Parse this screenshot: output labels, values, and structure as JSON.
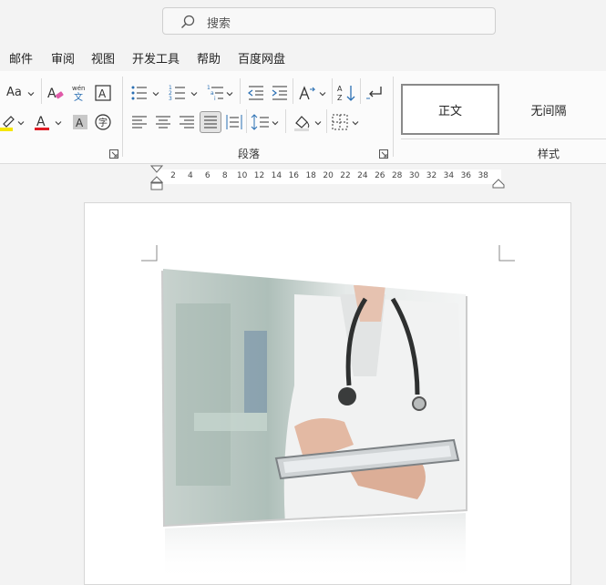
{
  "search": {
    "placeholder": "搜索"
  },
  "menu": {
    "items": [
      "邮件",
      "审阅",
      "视图",
      "开发工具",
      "帮助",
      "百度网盘"
    ]
  },
  "ribbon": {
    "font_group": {
      "change_case_label": "Aa"
    },
    "paragraph_group": {
      "label": "段落"
    },
    "styles_group": {
      "label": "样式",
      "styles": [
        "正文",
        "无间隔"
      ],
      "selected": "正文"
    }
  },
  "ruler": {
    "ticks": [
      "2",
      "4",
      "6",
      "8",
      "10",
      "12",
      "14",
      "16",
      "18",
      "20",
      "22",
      "24",
      "26",
      "28",
      "30",
      "32",
      "34",
      "36",
      "38"
    ]
  },
  "document": {
    "image": {
      "subject": "doctor-with-tablet-photo"
    }
  }
}
